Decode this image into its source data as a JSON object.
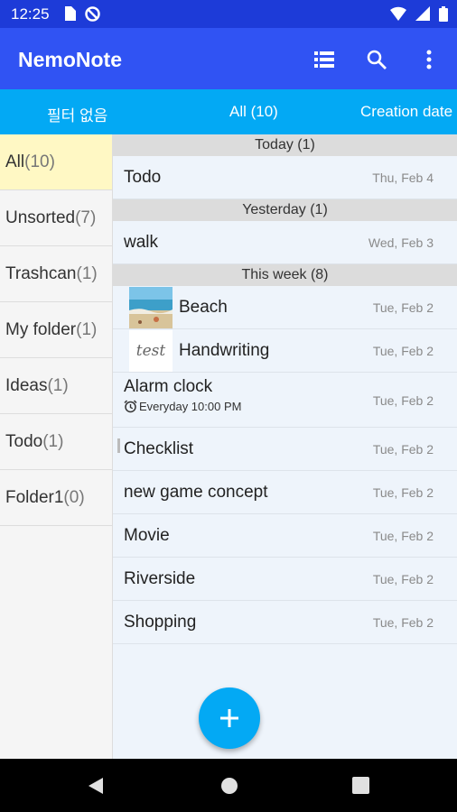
{
  "status_bar": {
    "time": "12:25"
  },
  "app_bar": {
    "title": "NemoNote"
  },
  "filter_bar": {
    "filter": "필터 없음",
    "scope": "All (10)",
    "sort": "Creation date"
  },
  "sidebar": {
    "folders": [
      {
        "name": "All",
        "count": "(10)"
      },
      {
        "name": "Unsorted",
        "count": "(7)"
      },
      {
        "name": "Trashcan",
        "count": "(1)"
      },
      {
        "name": "My folder",
        "count": "(1)"
      },
      {
        "name": "Ideas",
        "count": "(1)"
      },
      {
        "name": "Todo",
        "count": "(1)"
      },
      {
        "name": "Folder1",
        "count": "(0)"
      }
    ]
  },
  "groups": {
    "today": "Today (1)",
    "yesterday": "Yesterday (1)",
    "this_week": "This week (8)"
  },
  "notes": [
    {
      "title": "Todo",
      "date": "Thu, Feb 4"
    },
    {
      "title": "walk",
      "date": "Wed, Feb 3"
    },
    {
      "title": "Beach",
      "date": "Tue, Feb 2"
    },
    {
      "title": "Handwriting",
      "date": "Tue, Feb 2",
      "thumb_text": "test"
    },
    {
      "title": "Alarm clock",
      "date": "Tue, Feb 2",
      "reminder": "Everyday 10:00 PM"
    },
    {
      "title": "Checklist",
      "date": "Tue, Feb 2"
    },
    {
      "title": "new game concept",
      "date": "Tue, Feb 2"
    },
    {
      "title": "Movie",
      "date": "Tue, Feb 2"
    },
    {
      "title": "Riverside",
      "date": "Tue, Feb 2"
    },
    {
      "title": "Shopping",
      "date": "Tue, Feb 2"
    }
  ],
  "colors": {
    "status_bar": "#1d3bd8",
    "app_bar": "#3053f3",
    "filter_bar": "#03a9f4",
    "fab": "#03a9f4",
    "selected_folder": "#fff8c4"
  },
  "icons": [
    "list-view-icon",
    "search-icon",
    "more-vert-icon",
    "plus-icon",
    "back-icon",
    "home-icon",
    "recents-icon"
  ]
}
